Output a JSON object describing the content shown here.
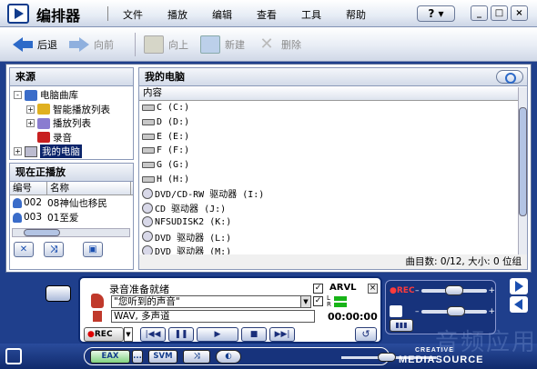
{
  "window": {
    "title": "编排器",
    "menu": [
      "文件",
      "播放",
      "编辑",
      "查看",
      "工具",
      "帮助"
    ],
    "help_button": "?",
    "controls": {
      "minimize": "_",
      "maximize": "□",
      "close": "×"
    }
  },
  "toolbar": {
    "back": "后退",
    "forward": "向前",
    "up": "向上",
    "new": "新建",
    "delete": "删除"
  },
  "source": {
    "title": "来源",
    "tree": [
      {
        "label": "电脑曲库",
        "expander": "-",
        "icon": "library-icon",
        "level": 0
      },
      {
        "label": "智能播放列表",
        "expander": "+",
        "icon": "smart-playlist-icon",
        "level": 1
      },
      {
        "label": "播放列表",
        "expander": "+",
        "icon": "playlist-icon",
        "level": 1
      },
      {
        "label": "录音",
        "expander": "",
        "icon": "recording-icon",
        "level": 1
      },
      {
        "label": "我的电脑",
        "expander": "+",
        "icon": "my-computer-icon",
        "level": 0,
        "selected": true
      }
    ]
  },
  "now_playing": {
    "title": "现在正播放",
    "columns": [
      "编号",
      "名称"
    ],
    "rows": [
      {
        "num": "002",
        "name": "08神仙也移民"
      },
      {
        "num": "003",
        "name": "01至爱"
      }
    ]
  },
  "my_computer": {
    "title": "我的电脑",
    "column": "内容",
    "drives": [
      {
        "label": "C (C:)",
        "icon": "hard-drive-icon"
      },
      {
        "label": "D (D:)",
        "icon": "hard-drive-icon"
      },
      {
        "label": "E (E:)",
        "icon": "hard-drive-icon"
      },
      {
        "label": "F (F:)",
        "icon": "hard-drive-icon"
      },
      {
        "label": "G (G:)",
        "icon": "hard-drive-icon"
      },
      {
        "label": "H (H:)",
        "icon": "hard-drive-icon"
      },
      {
        "label": "DVD/CD-RW 驱动器 (I:)",
        "icon": "cd-drive-icon"
      },
      {
        "label": "CD 驱动器 (J:)",
        "icon": "cd-drive-icon"
      },
      {
        "label": "NFSUDISK2 (K:)",
        "icon": "cd-drive-icon"
      },
      {
        "label": "DVD 驱动器 (L:)",
        "icon": "cd-drive-icon"
      },
      {
        "label": "DVD 驱动器 (M:)",
        "icon": "cd-drive-icon"
      }
    ],
    "status": "曲目数: 0/12, 大小: 0 位组"
  },
  "recorder": {
    "status": "录音准备就绪",
    "source": "\"您听到的声音\"",
    "format": "WAV, 多声道",
    "arvl_label": "ARVL",
    "arvl_checked": true,
    "meter_checked": true,
    "time": "00:00:00",
    "rec_label": "REC",
    "close_label": "×",
    "meter_l": "L",
    "meter_r": "R"
  },
  "mixer": {
    "rec_label": "REC",
    "rec_level": 0.5,
    "volume_level": 0.55
  },
  "footer": {
    "eax": "EAX",
    "svm": "SVM",
    "more": "...",
    "brand_top": "CREATIVE",
    "brand_bottom": "MEDIASOURCE",
    "watermark": "音频应用"
  },
  "colors": {
    "frame": "#1f3f8c",
    "selection": "#0a246a",
    "accent": "#2d6ac8",
    "rec_red": "#d00000",
    "meter_green": "#18b418"
  }
}
